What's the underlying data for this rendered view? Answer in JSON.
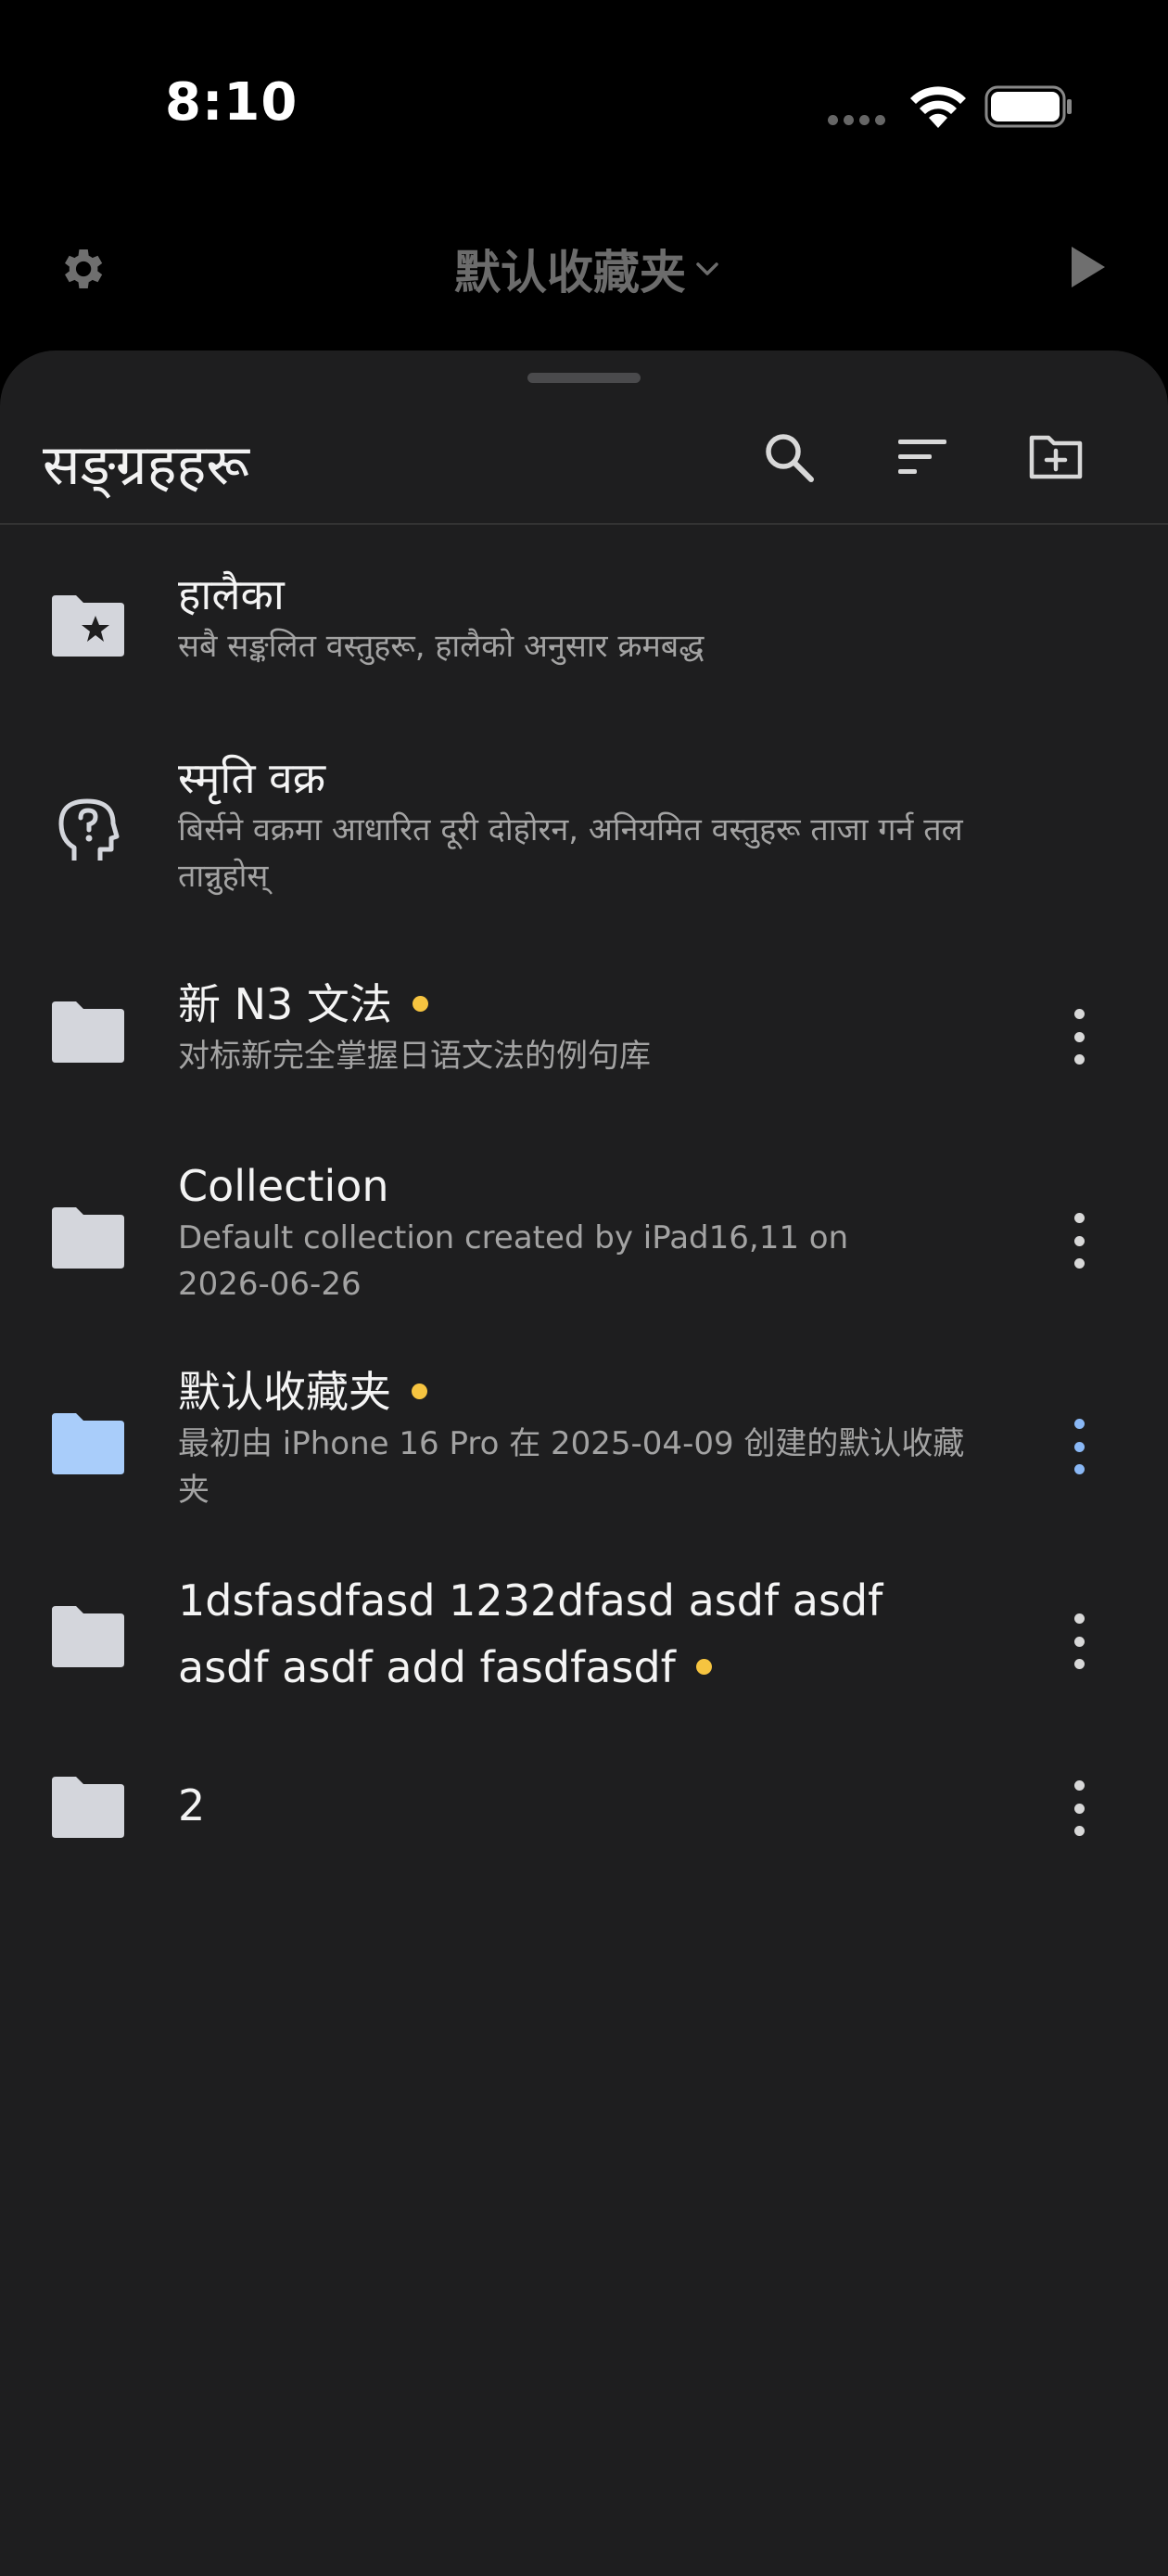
{
  "status_bar": {
    "time": "8:10"
  },
  "toolbar": {
    "current_folder": "默认收藏夹"
  },
  "sheet": {
    "title": "सङ्ग्रहहरू",
    "items": [
      {
        "title": "हालैका",
        "subtitle": "सबै सङ्कलित वस्तुहरू, हालैको अनुसार क्रमबद्ध",
        "icon": "folder-star-icon",
        "badge": false,
        "menu": false
      },
      {
        "title": "स्मृति वक्र",
        "subtitle": "बिर्सने वक्रमा आधारित दूरी दोहोरन, अनियमित वस्तुहरू ताजा गर्न तल तान्नुहोस्",
        "icon": "head-question-icon",
        "badge": false,
        "menu": false
      },
      {
        "title": "新 N3 文法",
        "subtitle": "对标新完全掌握日语文法的例句库",
        "icon": "folder-icon",
        "badge": true,
        "menu": true
      },
      {
        "title": "Collection",
        "subtitle": "Default collection created by iPad16,11 on 2026-06-26",
        "icon": "folder-icon",
        "badge": false,
        "menu": true
      },
      {
        "title": "默认收藏夹",
        "subtitle": "最初由 iPhone 16 Pro 在 2025-04-09 创建的默认收藏夹",
        "icon": "folder-icon",
        "badge": true,
        "menu": true,
        "active": true
      },
      {
        "title": "1dsfasdfasd 1232dfasd asdf asdf asdf asdf add fasdfasdf",
        "subtitle": "",
        "icon": "folder-icon",
        "badge": true,
        "menu": true
      },
      {
        "title": "2",
        "subtitle": "",
        "icon": "folder-icon",
        "badge": false,
        "menu": true
      }
    ]
  },
  "colors": {
    "badge": "#f6c440",
    "active_folder": "#a9cdfa",
    "folder": "#d4d6dc",
    "sheet_bg": "#1e1e1f"
  }
}
